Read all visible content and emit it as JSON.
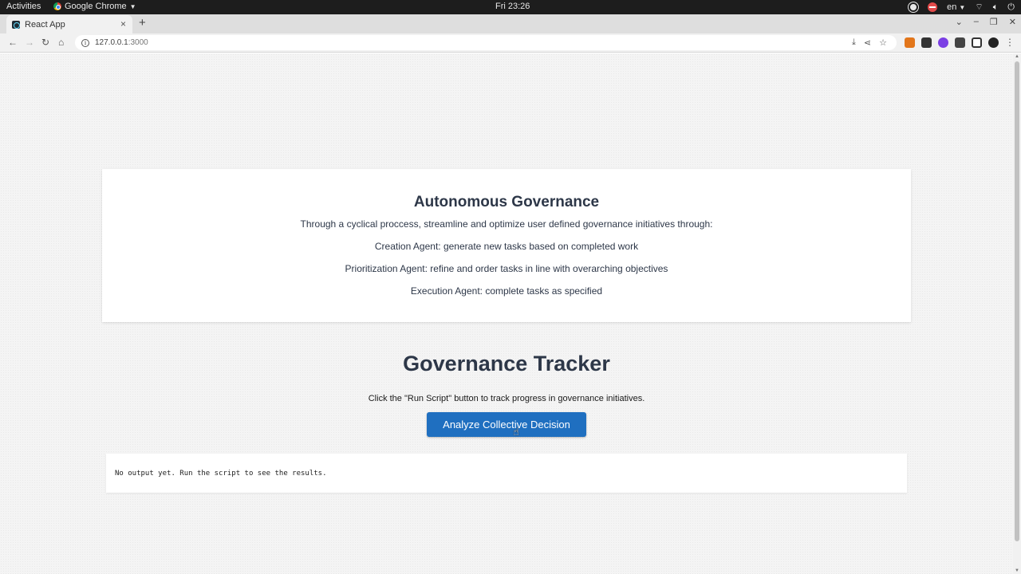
{
  "os_bar": {
    "activities": "Activities",
    "app_name": "Google Chrome",
    "clock": "Fri 23:26",
    "language": "en"
  },
  "browser": {
    "tab_title": "React App",
    "url_host": "127.0.0.1",
    "url_port": ":3000"
  },
  "page": {
    "info_card": {
      "title": "Autonomous Governance",
      "description": "Through a cyclical proccess, streamline and optimize user defined governance initiatives through:",
      "agents": [
        "Creation Agent: generate new tasks based on completed work",
        "Prioritization Agent: refine and order tasks in line with overarching objectives",
        "Execution Agent: complete tasks as specified"
      ]
    },
    "tracker": {
      "title": "Governance Tracker",
      "hint": "Click the \"Run Script\" button to track progress in governance initiatives.",
      "button_label": "Analyze Collective Decision"
    },
    "output": {
      "text": "No output yet. Run the script to see the results."
    }
  },
  "colors": {
    "button_bg": "#1f6fc0",
    "heading_text": "#2d3748"
  }
}
